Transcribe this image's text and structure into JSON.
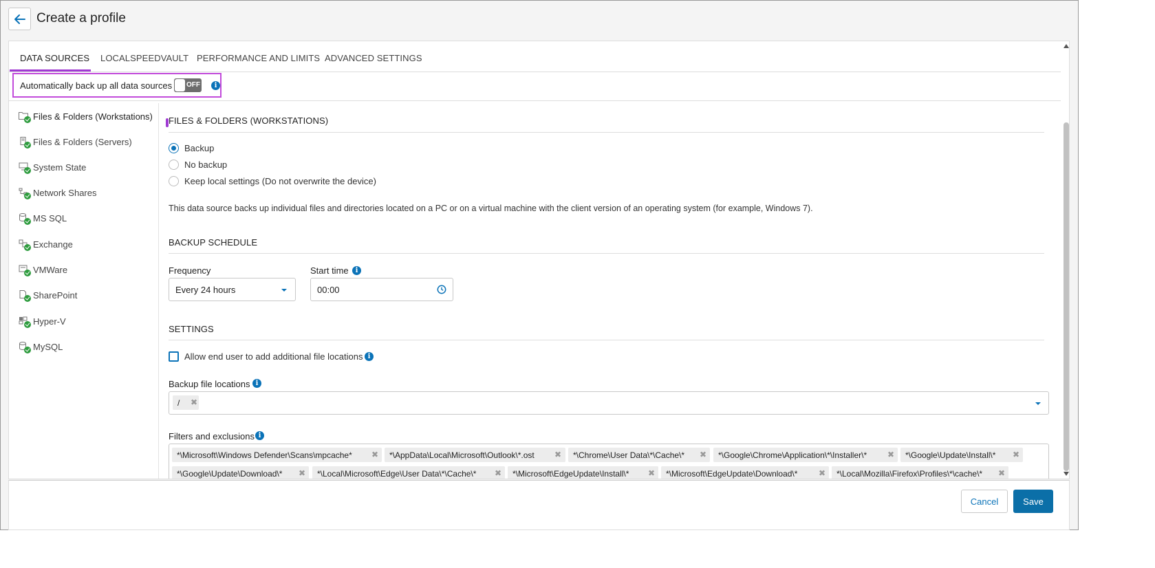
{
  "header": {
    "title": "Create a profile",
    "back_icon": "arrow-left-icon"
  },
  "tabs": [
    {
      "label": "DATA SOURCES",
      "active": true
    },
    {
      "label": "LOCALSPEEDVAULT",
      "active": false
    },
    {
      "label": "PERFORMANCE AND LIMITS",
      "active": false
    },
    {
      "label": "ADVANCED SETTINGS",
      "active": false
    }
  ],
  "auto_backup": {
    "label": "Automatically back up all data sources",
    "toggle_text": "OFF",
    "enabled": false
  },
  "nav": {
    "items": [
      {
        "label": "Files & Folders (Workstations)",
        "icon": "folder-icon",
        "status": "ok",
        "active": true
      },
      {
        "label": "Files & Folders (Servers)",
        "icon": "server-icon",
        "status": "ok",
        "active": false
      },
      {
        "label": "System State",
        "icon": "computer-icon",
        "status": "ok",
        "active": false
      },
      {
        "label": "Network Shares",
        "icon": "network-icon",
        "status": "ok",
        "active": false
      },
      {
        "label": "MS SQL",
        "icon": "database-icon",
        "status": "ok",
        "active": false
      },
      {
        "label": "Exchange",
        "icon": "exchange-icon",
        "status": "ok",
        "active": false
      },
      {
        "label": "VMWare",
        "icon": "vm-icon",
        "status": "ok",
        "active": false
      },
      {
        "label": "SharePoint",
        "icon": "sharepoint-icon",
        "status": "ok",
        "active": false
      },
      {
        "label": "Hyper-V",
        "icon": "hyperv-icon",
        "status": "ok",
        "active": false
      },
      {
        "label": "MySQL",
        "icon": "database-icon",
        "status": "ok",
        "active": false
      }
    ]
  },
  "main": {
    "section_title": "FILES & FOLDERS (WORKSTATIONS)",
    "radios": [
      {
        "label": "Backup",
        "selected": true
      },
      {
        "label": "No backup",
        "selected": false
      },
      {
        "label": "Keep local settings (Do not overwrite the device)",
        "selected": false
      }
    ],
    "description": "This data source backs up individual files and directories located on a PC or on a virtual machine with the client version of an operating system (for example, Windows 7).",
    "schedule": {
      "title": "BACKUP SCHEDULE",
      "frequency_label": "Frequency",
      "frequency_value": "Every 24 hours",
      "start_time_label": "Start time",
      "start_time_value": "00:00"
    },
    "settings": {
      "title": "SETTINGS",
      "allow_label": "Allow end user to add additional file locations",
      "allow_checked": false,
      "locations_label": "Backup file locations",
      "locations": [
        "/"
      ],
      "filters_label": "Filters and exclusions",
      "filters_row1": [
        "*\\Microsoft\\Windows Defender\\Scans\\mpcache*",
        "*\\AppData\\Local\\Microsoft\\Outlook\\*.ost",
        "*\\Chrome\\User Data\\*\\Cache\\*",
        "*\\Google\\Chrome\\Application\\*\\Installer\\*",
        "*\\Google\\Update\\Install\\*"
      ],
      "filters_row2": [
        "*\\Google\\Update\\Download\\*",
        "*\\Local\\Microsoft\\Edge\\User Data\\*\\Cache\\*",
        "*\\Microsoft\\EdgeUpdate\\Install\\*",
        "*\\Microsoft\\EdgeUpdate\\Download\\*",
        "*\\Local\\Mozilla\\Firefox\\Profiles\\*\\cache\\*"
      ]
    }
  },
  "footer": {
    "cancel_label": "Cancel",
    "save_label": "Save"
  },
  "colors": {
    "accent": "#0b73b8",
    "highlight": "#c24bdb",
    "success": "#2e9c3e",
    "tab_active": "#a03ad3"
  }
}
